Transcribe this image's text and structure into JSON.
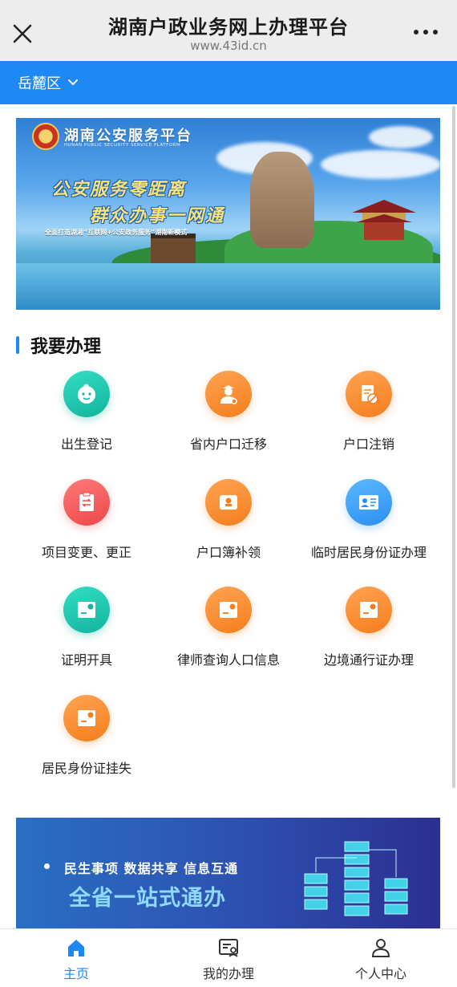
{
  "titlebar": {
    "title": "湖南户政业务网上办理平台",
    "url": "www.43id.cn"
  },
  "district": {
    "name": "岳麓区"
  },
  "banner_top": {
    "brand": "湖南公安服务平台",
    "brand_sub": "HUNAN PUBLIC SECURITY SERVICE PLATFORM",
    "slogan1": "公安服务零距离",
    "slogan2": "群众办事一网通",
    "tagline": "全面打造湖湘“互联网+公安政务服务”湖南新模式"
  },
  "section": {
    "title": "我要办理"
  },
  "services": [
    {
      "label": "出生登记",
      "color": "#10b59c",
      "icon": "baby-icon"
    },
    {
      "label": "省内户口迁移",
      "color": "#f57e1d",
      "icon": "officer-icon"
    },
    {
      "label": "户口注销",
      "color": "#f57e1d",
      "icon": "cancel-document-icon"
    },
    {
      "label": "项目变更、更正",
      "color": "#ec4747",
      "icon": "change-clipboard-icon"
    },
    {
      "label": "户口簿补领",
      "color": "#f57e1d",
      "icon": "household-book-icon"
    },
    {
      "label": "临时居民身份证办理",
      "color": "#2c8ef0",
      "icon": "id-card-icon"
    },
    {
      "label": "证明开具",
      "color": "#10b59c",
      "icon": "certificate-icon"
    },
    {
      "label": "律师查询人口信息",
      "color": "#f57e1d",
      "icon": "certificate-icon"
    },
    {
      "label": "边境通行证办理",
      "color": "#f57e1d",
      "icon": "certificate-icon"
    },
    {
      "label": "居民身份证挂失",
      "color": "#f57e1d",
      "icon": "certificate-icon"
    }
  ],
  "banner_bottom": {
    "line1": "民生事项  数据共享  信息互通",
    "line2": "全省一站式通办"
  },
  "nav": {
    "home": "主页",
    "my_tasks": "我的办理",
    "profile": "个人中心",
    "active_color": "#1e88f5"
  }
}
